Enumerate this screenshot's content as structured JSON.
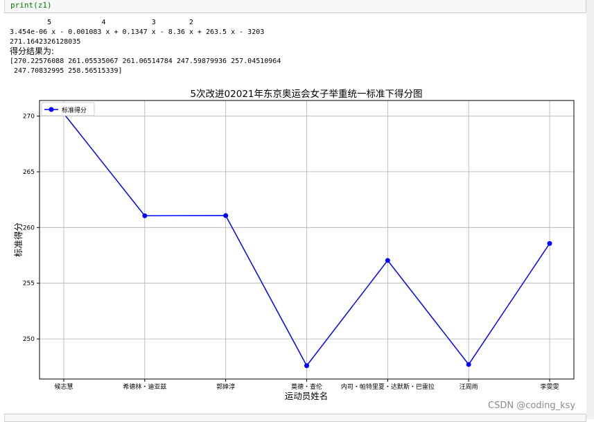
{
  "code": {
    "line": "print(z1)"
  },
  "output": {
    "poly_exponents": "         5            4           3        2",
    "poly_line": "3.454e-06 x - 0.001083 x + 0.1347 x - 8.36 x + 263.5 x - 3203",
    "scalar": "271.1642326128035",
    "result_label": "得分结果为:",
    "array_line1": "[270.22576088 261.05535067 261.06514784 247.59879936 257.04510964",
    "array_line2": " 247.70832995 258.56515339]"
  },
  "watermark": "CSDN @coding_ksy",
  "colors": {
    "line": "#0000ff",
    "grid": "#b0b0b0",
    "axes": "#000000"
  },
  "chart_data": {
    "type": "line",
    "title": "5次改进02021年东京奥运会女子举重统一标准下得分图",
    "xlabel": "运动员姓名",
    "ylabel": "标准得分",
    "categories": [
      "候志慧",
      "希德林・迪亚兹",
      "郭婞淳",
      "莫德・查伦",
      "内司・帕特里夏・达默斯・巴雷拉",
      "汪周雨",
      "李雯雯"
    ],
    "series": [
      {
        "name": "标准得分",
        "values": [
          270.22576088,
          261.05535067,
          261.06514784,
          247.59879936,
          257.04510964,
          247.70832995,
          258.56515339
        ]
      }
    ],
    "yticks": [
      250,
      255,
      260,
      265,
      270
    ],
    "ylim": [
      246.4,
      271.4
    ],
    "grid": true,
    "legend": "top-left",
    "marker": "circle"
  }
}
